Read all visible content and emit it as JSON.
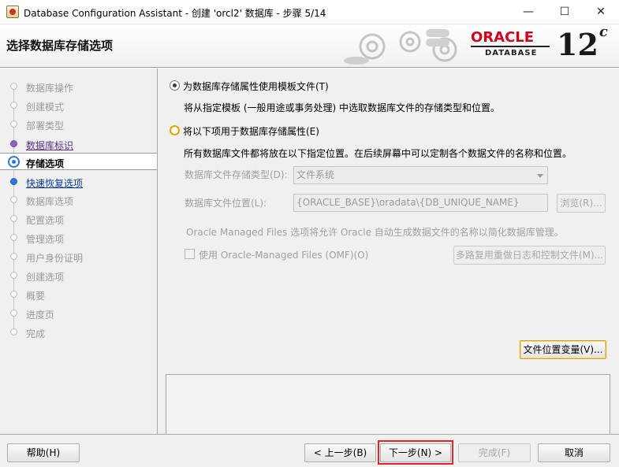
{
  "window": {
    "title": "Database Configuration Assistant - 创建 'orcl2' 数据库 - 步骤 5/14",
    "controls": {
      "minimize": "—",
      "maximize": "☐",
      "close": "✕"
    }
  },
  "header": {
    "title": "选择数据库存储选项",
    "logo_word": "ORACLE",
    "logo_sub": "DATABASE",
    "version": "12",
    "version_suffix": "c"
  },
  "steps": [
    {
      "label": "数据库操作",
      "state": "disabled"
    },
    {
      "label": "创建模式",
      "state": "disabled"
    },
    {
      "label": "部署类型",
      "state": "disabled"
    },
    {
      "label": "数据库标识",
      "state": "visited"
    },
    {
      "label": "存储选项",
      "state": "current"
    },
    {
      "label": "快速恢复选项",
      "state": "link"
    },
    {
      "label": "数据库选项",
      "state": "disabled"
    },
    {
      "label": "配置选项",
      "state": "disabled"
    },
    {
      "label": "管理选项",
      "state": "disabled"
    },
    {
      "label": "用户身份证明",
      "state": "disabled"
    },
    {
      "label": "创建选项",
      "state": "disabled"
    },
    {
      "label": "概要",
      "state": "disabled"
    },
    {
      "label": "进度页",
      "state": "disabled"
    },
    {
      "label": "完成",
      "state": "disabled"
    }
  ],
  "main": {
    "option_template": {
      "label": "为数据库存储属性使用模板文件(T)",
      "desc": "将从指定模板 (一般用途或事务处理) 中选取数据库文件的存储类型和位置。",
      "selected": true
    },
    "option_custom": {
      "label": "将以下项用于数据库存储属性(E)",
      "desc": "所有数据库文件都将放在以下指定位置。在后续屏幕中可以定制各个数据文件的名称和位置。",
      "selected": false
    },
    "storage_type_label": "数据库文件存储类型(D):",
    "storage_type_value": "文件系统",
    "file_location_label": "数据库文件位置(L):",
    "file_location_value": "{ORACLE_BASE}\\oradata\\{DB_UNIQUE_NAME}",
    "browse_button": "浏览(R)...",
    "omf_note": "Oracle Managed Files 选项将允许 Oracle 自动生成数据文件的名称以简化数据库管理。",
    "omf_checkbox": "使用 Oracle-Managed Files (OMF)(O)",
    "multiplex_button": "多路复用重做日志和控制文件(M)...",
    "file_vars_button": "文件位置变量(V)..."
  },
  "footer": {
    "help": "帮助(H)",
    "back": "< 上一步(B)",
    "next": "下一步(N) >",
    "finish": "完成(F)",
    "cancel": "取消"
  },
  "colors": {
    "oracle_red": "#d0021b",
    "link_blue": "#0a3c9a",
    "visited_purple": "#5b2c86",
    "focus_orange": "#e0a000",
    "highlight_red": "#e3242b"
  }
}
